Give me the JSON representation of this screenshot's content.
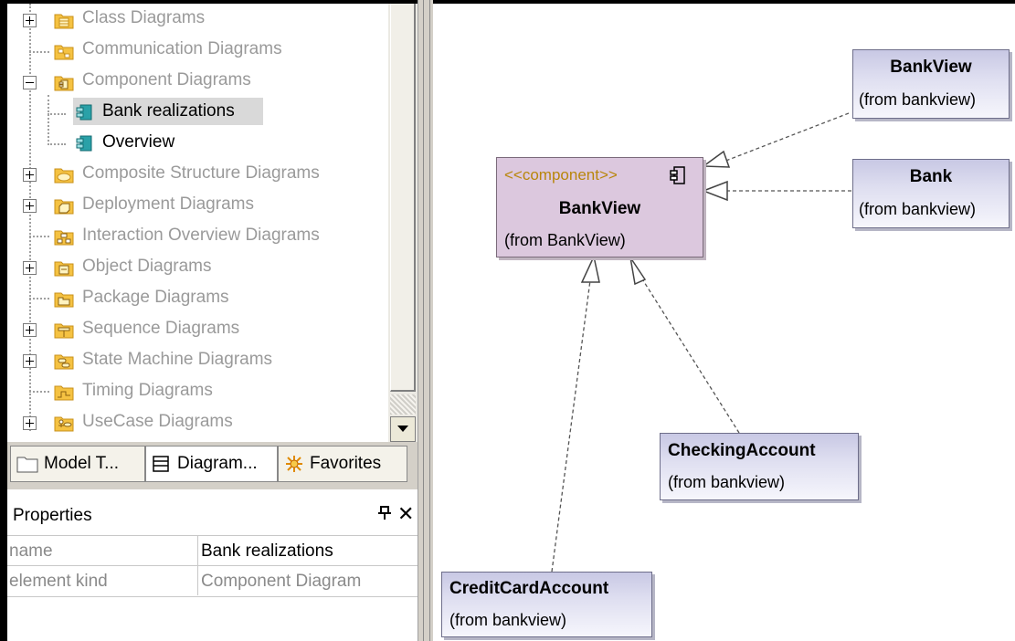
{
  "model_tree": {
    "items": [
      {
        "label": "Class Diagrams",
        "icon": "class-diagram-folder-icon",
        "expander": "plus"
      },
      {
        "label": "Communication Diagrams",
        "icon": "communication-diagram-folder-icon",
        "expander": "none"
      },
      {
        "label": "Component Diagrams",
        "icon": "component-diagram-folder-icon",
        "expander": "minus"
      },
      {
        "label": "Bank realizations",
        "icon": "component-diagram-icon",
        "selected": true
      },
      {
        "label": "Overview",
        "icon": "component-diagram-icon"
      },
      {
        "label": "Composite Structure Diagrams",
        "icon": "composite-structure-folder-icon",
        "expander": "plus"
      },
      {
        "label": "Deployment Diagrams",
        "icon": "deployment-diagram-folder-icon",
        "expander": "plus"
      },
      {
        "label": "Interaction Overview Diagrams",
        "icon": "interaction-overview-folder-icon",
        "expander": "none"
      },
      {
        "label": "Object Diagrams",
        "icon": "object-diagram-folder-icon",
        "expander": "plus"
      },
      {
        "label": "Package Diagrams",
        "icon": "package-diagram-folder-icon",
        "expander": "none"
      },
      {
        "label": "Sequence Diagrams",
        "icon": "sequence-diagram-folder-icon",
        "expander": "plus"
      },
      {
        "label": "State Machine Diagrams",
        "icon": "state-machine-folder-icon",
        "expander": "plus"
      },
      {
        "label": "Timing Diagrams",
        "icon": "timing-diagram-folder-icon",
        "expander": "none"
      },
      {
        "label": "UseCase Diagrams",
        "icon": "usecase-diagram-folder-icon",
        "expander": "plus"
      }
    ]
  },
  "tabs": [
    {
      "label": "Model T...",
      "icon": "folder-icon"
    },
    {
      "label": "Diagram...",
      "icon": "diagram-tree-icon",
      "active": true
    },
    {
      "label": "Favorites",
      "icon": "favorites-star-icon"
    }
  ],
  "properties": {
    "title": "Properties",
    "pin_glyph": "ᵖ",
    "close_glyph": "✕",
    "rows": [
      {
        "name": "name",
        "value": "Bank realizations"
      },
      {
        "name": "element kind",
        "value": "Component Diagram"
      }
    ]
  },
  "diagram": {
    "component": {
      "stereotype": "<<component>>",
      "name": "BankView",
      "from": "(from BankView)"
    },
    "classes": [
      {
        "id": "bankview",
        "name": "BankView",
        "from": "(from bankview)"
      },
      {
        "id": "bank",
        "name": "Bank",
        "from": "(from bankview)"
      },
      {
        "id": "checking",
        "name": "CheckingAccount",
        "from": "(from bankview)"
      },
      {
        "id": "creditcard",
        "name": "CreditCardAccount",
        "from": "(from bankview)"
      }
    ]
  },
  "colors": {
    "stereotype": "#b8860b",
    "component_fill": "#dcc8de",
    "class_fill_top": "#c8c8e4",
    "folder_yellow": "#f5c242",
    "diagram_teal": "#2aa1a8"
  }
}
